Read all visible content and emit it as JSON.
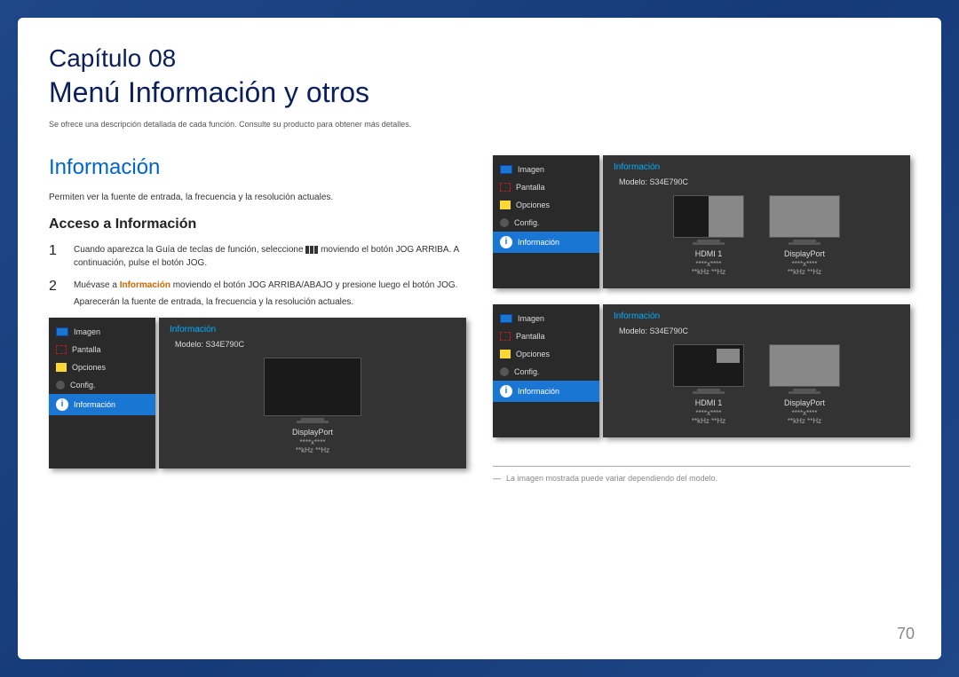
{
  "chapter_number": "Capítulo 08",
  "chapter_title": "Menú Información y otros",
  "chapter_desc": "Se ofrece una descripción detallada de cada función. Consulte su producto para obtener más detalles.",
  "section_title": "Información",
  "section_desc": "Permiten ver la fuente de entrada, la frecuencia y la resolución actuales.",
  "subsection_title": "Acceso a Información",
  "steps": {
    "1": {
      "num": "1",
      "pre": "Cuando aparezca la Guía de teclas de función, seleccione ",
      "post": " moviendo el botón JOG ARRIBA. A continuación, pulse el botón JOG."
    },
    "2": {
      "num": "2",
      "pre": "Muévase a ",
      "highlight": "Información",
      "mid": " moviendo el botón JOG ARRIBA/ABAJO y presione luego el botón JOG.",
      "post": "Aparecerán la fuente de entrada, la frecuencia y la resolución actuales."
    }
  },
  "osd": {
    "sidebar": {
      "imagen": "Imagen",
      "pantalla": "Pantalla",
      "opciones": "Opciones",
      "config": "Config.",
      "informacion": "Información"
    },
    "panel_title": "Información",
    "model": "Modelo: S34E790C",
    "source_hdmi": "HDMI 1",
    "source_dp": "DisplayPort",
    "res": "****x****",
    "hz": "**kHz **Hz"
  },
  "footnote": "La imagen mostrada puede variar dependiendo del modelo.",
  "page_number": "70"
}
